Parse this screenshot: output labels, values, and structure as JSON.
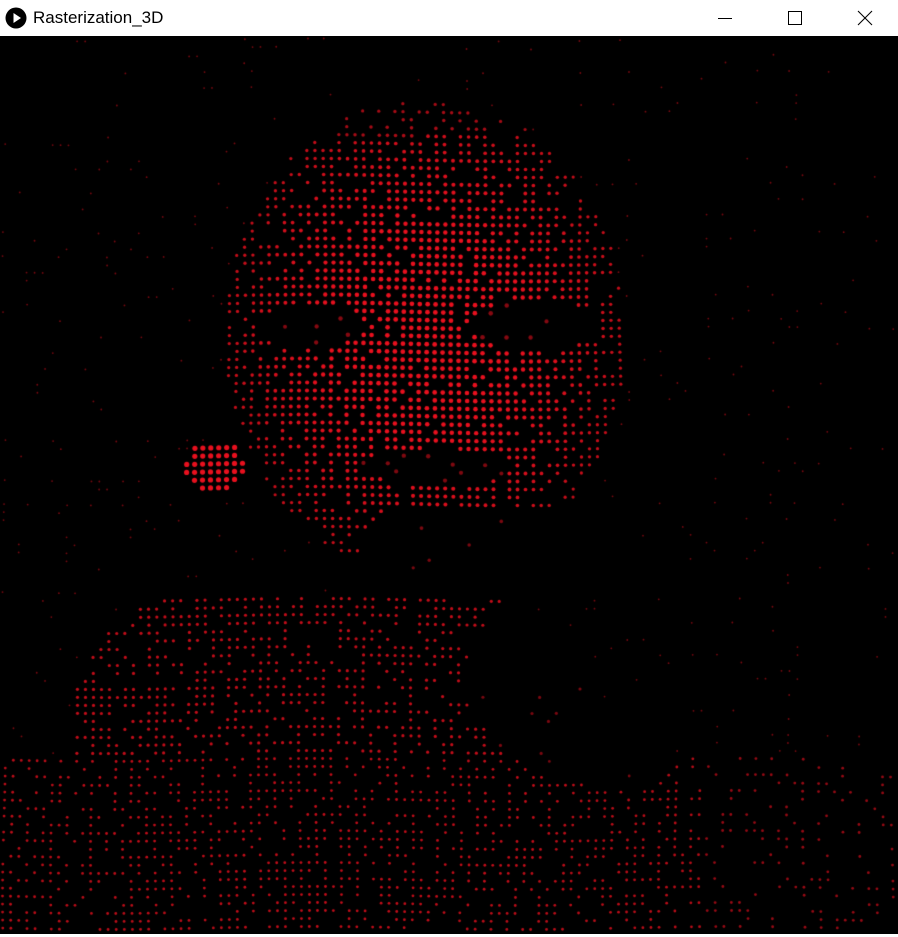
{
  "window": {
    "title": "Rasterization_3D",
    "icons": {
      "app": "play-icon",
      "minimize": "minimize-icon",
      "maximize": "maximize-icon",
      "close": "close-icon"
    }
  },
  "sketch": {
    "background_color": "#000000",
    "point_color": "#e8101e",
    "content": "red point-cloud rendering of a face"
  }
}
